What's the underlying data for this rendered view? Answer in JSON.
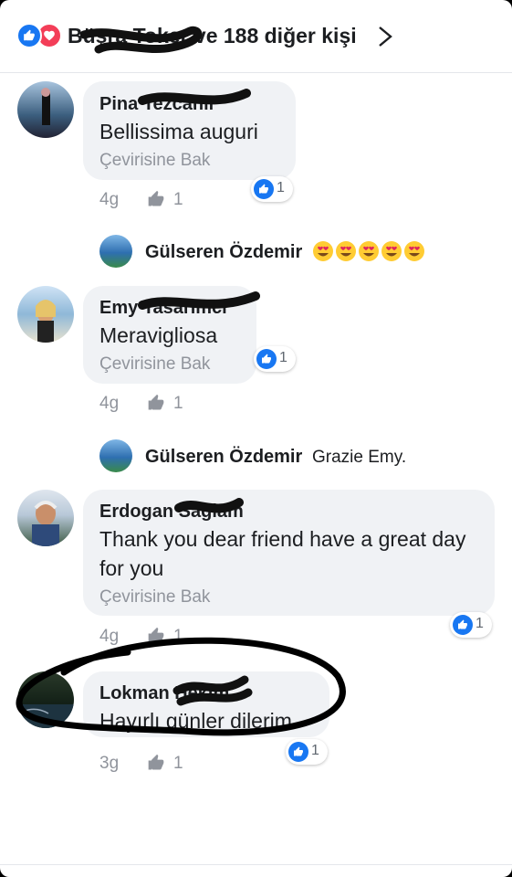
{
  "header": {
    "reactions_text": "Büşra Toker ve 188 diğer kişi"
  },
  "comments": [
    {
      "name": "Pina Tezcanlı",
      "text": "Bellissima auguri",
      "translate": "Çevirisine Bak",
      "time": "4g",
      "likes": "1",
      "reaction_count": "1"
    },
    {
      "name": "Emy Tasarımcı",
      "text": "Meravigliosa",
      "translate": "Çevirisine Bak",
      "time": "4g",
      "likes": "1",
      "reaction_count": "1"
    },
    {
      "name": "Erdogan Sağlam",
      "text": "Thank you dear friend have a great day for you",
      "translate": "Çevirisine Bak",
      "time": "4g",
      "likes": "1",
      "reaction_count": "1"
    },
    {
      "name": "Lokman Hekim",
      "text": "Hayırlı günler dilerim",
      "time": "3g",
      "likes": "1",
      "reaction_count": "1"
    }
  ],
  "replies": [
    {
      "name": "Gülseren Özdemir",
      "text": "",
      "emoji": "heart-eyes-emoji x5"
    },
    {
      "name": "Gülseren Özdemir",
      "text": "Grazie Emy."
    }
  ],
  "colors": {
    "brand_blue": "#1877f2",
    "love_red": "#f33e58",
    "bubble": "#f0f2f5",
    "meta_grey": "#90949c"
  }
}
